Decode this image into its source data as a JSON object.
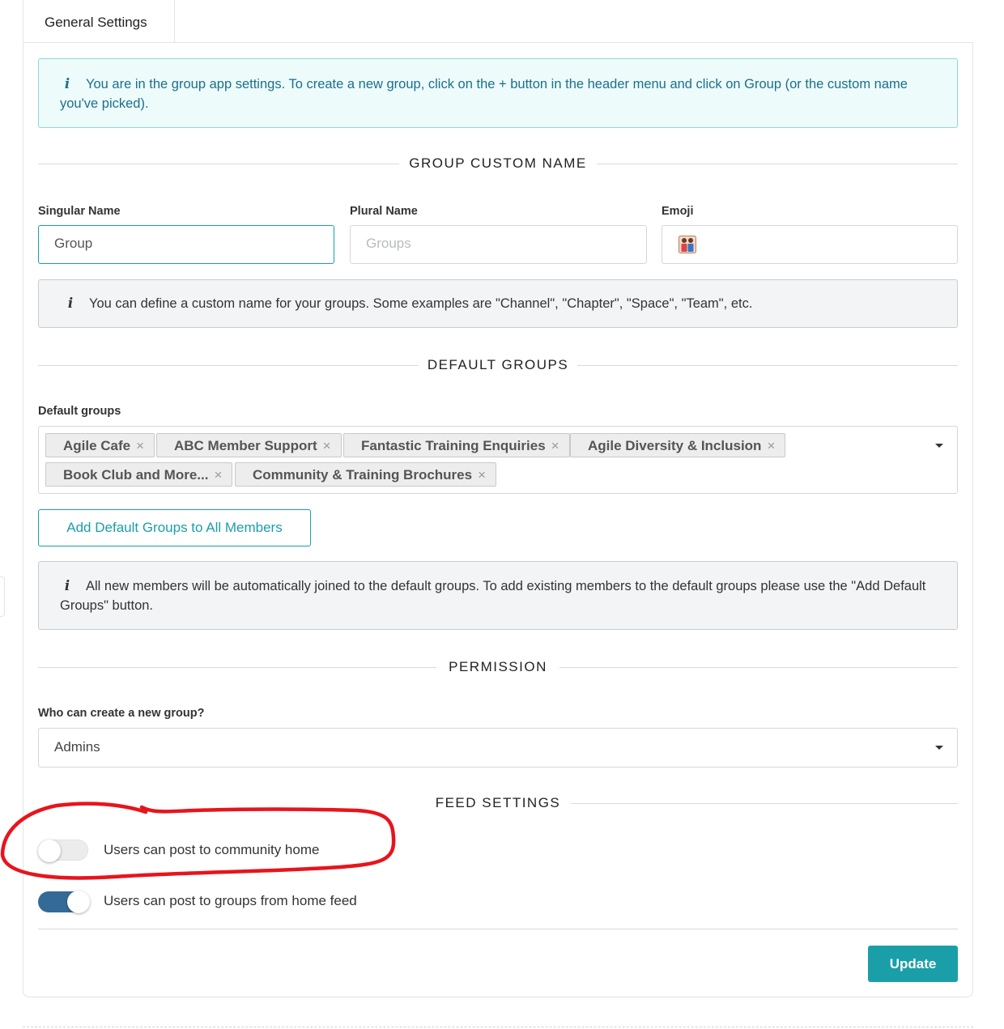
{
  "tabs": [
    {
      "label": "General Settings",
      "active": true
    }
  ],
  "info_banner": {
    "icon": "info-icon",
    "text": "You are in the group app settings. To create a new group, click on the + button in the header menu and click on Group (or the custom name you've picked)."
  },
  "group_custom_name": {
    "section_title": "GROUP CUSTOM NAME",
    "singular": {
      "label": "Singular Name",
      "value": "Group"
    },
    "plural": {
      "label": "Plural Name",
      "placeholder": "Groups"
    },
    "emoji": {
      "label": "Emoji",
      "value": "people-holding-hands-emoji"
    },
    "hint": "You can define a custom name for your groups. Some examples are \"Channel\", \"Chapter\", \"Space\", \"Team\", etc."
  },
  "default_groups": {
    "section_title": "DEFAULT GROUPS",
    "label": "Default groups",
    "selected": [
      "Agile Cafe",
      "ABC Member Support",
      "Fantastic Training Enquiries",
      "Agile Diversity & Inclusion",
      "Book Club and More...",
      "Community & Training Brochures"
    ],
    "remove_symbol": "×",
    "add_button": "Add Default Groups to All Members",
    "hint": "All new members will be automatically joined to the default groups. To add existing members to the default groups please use the \"Add Default Groups\" button."
  },
  "permission": {
    "section_title": "PERMISSION",
    "label": "Who can create a new group?",
    "value": "Admins"
  },
  "feed_settings": {
    "section_title": "FEED SETTINGS",
    "toggles": [
      {
        "label": "Users can post to community home",
        "on": false
      },
      {
        "label": "Users can post to groups from home feed",
        "on": true
      }
    ]
  },
  "actions": {
    "update": "Update"
  },
  "colors": {
    "accent": "#1a9fa8",
    "toggle_on": "#336b96",
    "annotation": "#e8141c",
    "info_bg": "#edfbfb"
  }
}
